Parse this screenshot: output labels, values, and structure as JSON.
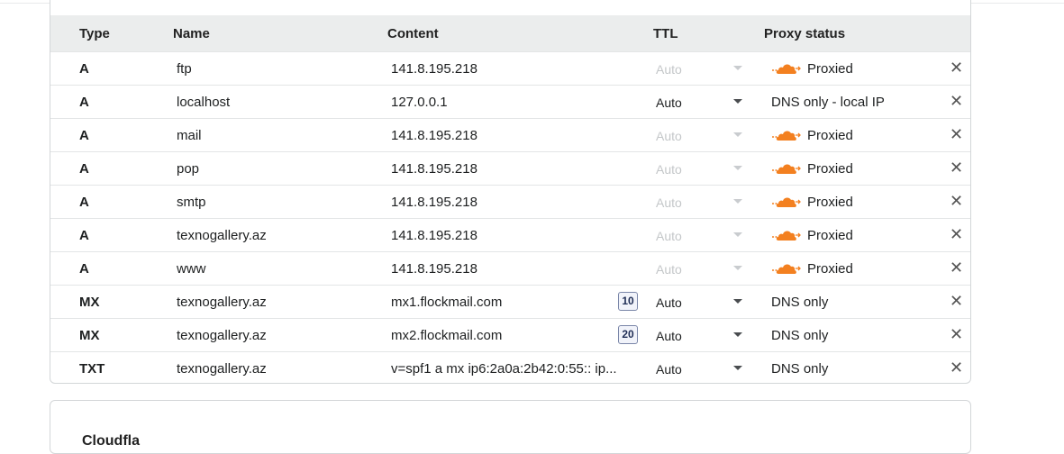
{
  "headers": {
    "type": "Type",
    "name": "Name",
    "content": "Content",
    "ttl": "TTL",
    "proxy": "Proxy status"
  },
  "rows": [
    {
      "type": "A",
      "name": "ftp",
      "content": "141.8.195.218",
      "priority": "",
      "ttl": "Auto",
      "ttl_editable": false,
      "proxy": "Proxied",
      "proxied": true
    },
    {
      "type": "A",
      "name": "localhost",
      "content": "127.0.0.1",
      "priority": "",
      "ttl": "Auto",
      "ttl_editable": true,
      "proxy": "DNS only - local IP",
      "proxied": false
    },
    {
      "type": "A",
      "name": "mail",
      "content": "141.8.195.218",
      "priority": "",
      "ttl": "Auto",
      "ttl_editable": false,
      "proxy": "Proxied",
      "proxied": true
    },
    {
      "type": "A",
      "name": "pop",
      "content": "141.8.195.218",
      "priority": "",
      "ttl": "Auto",
      "ttl_editable": false,
      "proxy": "Proxied",
      "proxied": true
    },
    {
      "type": "A",
      "name": "smtp",
      "content": "141.8.195.218",
      "priority": "",
      "ttl": "Auto",
      "ttl_editable": false,
      "proxy": "Proxied",
      "proxied": true
    },
    {
      "type": "A",
      "name": "texnogallery.az",
      "content": "141.8.195.218",
      "priority": "",
      "ttl": "Auto",
      "ttl_editable": false,
      "proxy": "Proxied",
      "proxied": true
    },
    {
      "type": "A",
      "name": "www",
      "content": "141.8.195.218",
      "priority": "",
      "ttl": "Auto",
      "ttl_editable": false,
      "proxy": "Proxied",
      "proxied": true
    },
    {
      "type": "MX",
      "name": "texnogallery.az",
      "content": "mx1.flockmail.com",
      "priority": "10",
      "ttl": "Auto",
      "ttl_editable": true,
      "proxy": "DNS only",
      "proxied": false
    },
    {
      "type": "MX",
      "name": "texnogallery.az",
      "content": "mx2.flockmail.com",
      "priority": "20",
      "ttl": "Auto",
      "ttl_editable": true,
      "proxy": "DNS only",
      "proxied": false
    },
    {
      "type": "TXT",
      "name": "texnogallery.az",
      "content": "v=spf1 a mx ip6:2a0a:2b42:0:55:: ip...",
      "priority": "",
      "ttl": "Auto",
      "ttl_editable": true,
      "proxy": "DNS only",
      "proxied": false
    }
  ],
  "icons": {
    "proxied": "orange-cloud-icon",
    "delete": "close-icon",
    "ttl_dropdown": "caret-down-icon"
  },
  "colors": {
    "cloud": "#f38020",
    "header_bg": "#ebeded"
  },
  "next_section": {
    "title": "Cloudfla"
  }
}
